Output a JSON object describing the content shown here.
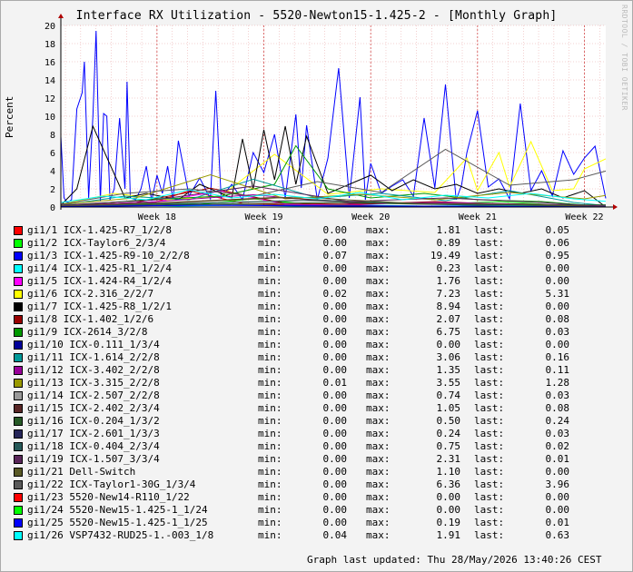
{
  "title": "Interface RX Utilization - 5520-Newton15-1.425-2 - [Monthly Graph]",
  "watermark": "RRDTOOL / TOBI OETIKER",
  "updated_text": "Graph last updated: Thu 28/May/2026 13:40:26 CEST",
  "legend_labels": {
    "min": "min:",
    "max": "max:",
    "last": "last:"
  },
  "colors": {
    "background": "#f3f3f3",
    "plot": "#ffffff",
    "grid": "#e7a2a2",
    "axis": "#000000"
  },
  "chart_data": {
    "type": "line",
    "title": "Interface RX Utilization - 5520-Newton15-1.425-2 - [Monthly Graph]",
    "xlabel": "",
    "ylabel": "Percent",
    "ylim": [
      0,
      20
    ],
    "yticks": [
      0,
      2,
      4,
      6,
      8,
      10,
      12,
      14,
      16,
      18,
      20
    ],
    "xlim": [
      17.1,
      22.2
    ],
    "xticks": [
      {
        "value": 18,
        "label": "Week 18"
      },
      {
        "value": 19,
        "label": "Week 19"
      },
      {
        "value": 20,
        "label": "Week 20"
      },
      {
        "value": 21,
        "label": "Week 21"
      },
      {
        "value": 22,
        "label": "Week 22"
      }
    ],
    "grid": true,
    "legend_position": "bottom",
    "series": [
      {
        "name": "gi1/1 ICX-1.425-R7_1/2/8",
        "color": "#ff0000",
        "min": "0.00",
        "max": "1.81",
        "last": "0.05",
        "x": [
          17.1,
          17.6,
          17.9,
          18.3,
          18.8,
          19.4,
          19.9,
          20.4,
          20.9,
          21.4,
          21.9,
          22.2
        ],
        "values": [
          0.1,
          0.3,
          0.2,
          1.8,
          0.4,
          0.2,
          0.3,
          0.5,
          0.2,
          0.3,
          0.2,
          0.05
        ]
      },
      {
        "name": "gi1/2 ICX-Taylor6_2/3/4",
        "color": "#00ff00",
        "min": "0.00",
        "max": "0.89",
        "last": "0.06",
        "x": [
          17.1,
          17.8,
          18.4,
          18.9,
          19.5,
          20.1,
          20.6,
          21.2,
          21.8,
          22.2
        ],
        "values": [
          0.1,
          0.5,
          0.3,
          0.9,
          0.2,
          0.4,
          0.3,
          0.6,
          0.2,
          0.06
        ]
      },
      {
        "name": "gi1/3 ICX-1.425-R9-10_2/2/8",
        "color": "#0000ff",
        "min": "0.07",
        "max": "19.49",
        "last": "0.95",
        "x": [
          17.1,
          17.13,
          17.16,
          17.2,
          17.25,
          17.3,
          17.32,
          17.36,
          17.4,
          17.43,
          17.47,
          17.5,
          17.53,
          17.56,
          17.6,
          17.65,
          17.7,
          17.72,
          17.75,
          17.8,
          17.85,
          17.9,
          17.95,
          18.0,
          18.05,
          18.1,
          18.15,
          18.2,
          18.3,
          18.4,
          18.5,
          18.55,
          18.6,
          18.7,
          18.8,
          18.9,
          19.0,
          19.1,
          19.2,
          19.3,
          19.35,
          19.4,
          19.5,
          19.6,
          19.7,
          19.8,
          19.9,
          19.95,
          20.0,
          20.1,
          20.2,
          20.3,
          20.4,
          20.5,
          20.6,
          20.7,
          20.8,
          20.85,
          20.9,
          21.0,
          21.1,
          21.2,
          21.3,
          21.4,
          21.5,
          21.6,
          21.7,
          21.8,
          21.9,
          22.0,
          22.1,
          22.2
        ],
        "values": [
          7.8,
          1.0,
          0.5,
          0.8,
          10.8,
          12.6,
          16.0,
          1.0,
          10.0,
          19.4,
          0.6,
          10.3,
          10.0,
          0.8,
          2.0,
          9.8,
          2.0,
          13.8,
          1.0,
          0.8,
          2.0,
          4.5,
          0.7,
          3.5,
          1.5,
          4.5,
          0.8,
          7.3,
          1.2,
          3.2,
          0.9,
          12.8,
          1.0,
          2.5,
          0.8,
          6.0,
          3.8,
          8.0,
          1.0,
          10.2,
          2.1,
          9.0,
          0.8,
          5.4,
          15.3,
          1.0,
          12.1,
          0.8,
          4.8,
          1.5,
          2.3,
          3.0,
          1.2,
          9.8,
          2.1,
          13.5,
          0.8,
          2.4,
          6.0,
          10.6,
          2.2,
          3.1,
          0.9,
          11.4,
          1.8,
          4.0,
          1.2,
          6.2,
          3.6,
          5.4,
          6.7,
          0.95
        ]
      },
      {
        "name": "gi1/4 ICX-1.425-R1_1/2/4",
        "color": "#00ffff",
        "min": "0.00",
        "max": "0.23",
        "last": "0.00",
        "x": [
          17.1,
          17.7,
          18.2,
          18.8,
          19.3,
          19.9,
          20.5,
          21.0,
          21.6,
          22.2
        ],
        "values": [
          0.1,
          0.2,
          0.1,
          0.2,
          0.1,
          0.23,
          0.1,
          0.15,
          0.1,
          0.0
        ]
      },
      {
        "name": "gi1/5 ICX-1.424-R4_1/2/4",
        "color": "#ff00ff",
        "min": "0.00",
        "max": "1.76",
        "last": "0.00",
        "x": [
          17.1,
          17.9,
          18.6,
          19.2,
          19.8,
          20.4,
          21.1,
          21.7,
          22.2
        ],
        "values": [
          0.1,
          0.4,
          1.76,
          0.3,
          0.2,
          0.5,
          0.3,
          0.2,
          0.0
        ]
      },
      {
        "name": "gi1/6 ICX-2.316_2/2/7",
        "color": "#ffff00",
        "min": "0.02",
        "max": "7.23",
        "last": "5.31",
        "x": [
          17.1,
          17.6,
          18.1,
          18.6,
          19.1,
          19.6,
          20.1,
          20.6,
          20.9,
          21.0,
          21.2,
          21.3,
          21.5,
          21.7,
          21.9,
          22.0,
          22.2
        ],
        "values": [
          0.3,
          1.5,
          0.8,
          1.2,
          5.8,
          1.4,
          2.0,
          1.6,
          5.4,
          1.8,
          6.0,
          2.2,
          7.2,
          1.8,
          2.0,
          4.2,
          5.31
        ]
      },
      {
        "name": "gi1/7 ICX-1.425-R8_1/2/1",
        "color": "#000000",
        "min": "0.00",
        "max": "8.94",
        "last": "0.00",
        "x": [
          17.1,
          17.25,
          17.4,
          17.7,
          17.9,
          18.2,
          18.4,
          18.7,
          18.8,
          18.9,
          19.0,
          19.1,
          19.2,
          19.3,
          19.4,
          19.6,
          19.8,
          20.0,
          20.2,
          20.4,
          20.6,
          20.8,
          21.0,
          21.2,
          21.4,
          21.6,
          21.8,
          22.0,
          22.2
        ],
        "values": [
          0.2,
          2.0,
          8.9,
          1.0,
          1.5,
          0.8,
          2.5,
          1.0,
          7.5,
          2.0,
          8.5,
          3.0,
          8.9,
          2.5,
          7.8,
          1.5,
          2.5,
          3.5,
          1.8,
          3.0,
          2.0,
          2.5,
          1.5,
          2.0,
          1.5,
          2.0,
          1.0,
          1.8,
          0.0
        ]
      },
      {
        "name": "gi1/8 ICX-1.402_1/2/6",
        "color": "#990000",
        "min": "0.00",
        "max": "2.07",
        "last": "0.08",
        "x": [
          17.1,
          17.8,
          18.5,
          19.2,
          19.9,
          20.6,
          21.3,
          22.2
        ],
        "values": [
          0.1,
          0.5,
          2.07,
          0.4,
          0.3,
          0.6,
          0.3,
          0.08
        ]
      },
      {
        "name": "gi1/9 ICX-2614_3/2/8",
        "color": "#009900",
        "min": "0.00",
        "max": "6.75",
        "last": "0.03",
        "x": [
          17.1,
          17.9,
          18.6,
          19.1,
          19.3,
          19.6,
          20.0,
          20.5,
          21.0,
          21.6,
          22.2
        ],
        "values": [
          0.1,
          0.8,
          1.2,
          2.5,
          6.75,
          2.0,
          1.0,
          1.5,
          0.8,
          0.6,
          0.03
        ]
      },
      {
        "name": "gi1/10 ICX-0.111_1/3/4",
        "color": "#000099",
        "min": "0.00",
        "max": "0.00",
        "last": "0.00",
        "x": [
          17.1,
          22.2
        ],
        "values": [
          0,
          0
        ]
      },
      {
        "name": "gi1/11 ICX-1.614_2/2/8",
        "color": "#009999",
        "min": "0.00",
        "max": "3.06",
        "last": "0.16",
        "x": [
          17.1,
          17.7,
          18.3,
          18.9,
          19.5,
          20.1,
          20.7,
          21.3,
          21.9,
          22.2
        ],
        "values": [
          0.2,
          1.2,
          0.8,
          3.06,
          1.0,
          1.5,
          0.7,
          1.8,
          0.5,
          0.16
        ]
      },
      {
        "name": "gi1/12 ICX-3.402_2/2/8",
        "color": "#990099",
        "min": "0.00",
        "max": "1.35",
        "last": "0.11",
        "x": [
          17.1,
          18.0,
          18.9,
          19.8,
          20.7,
          21.6,
          22.2
        ],
        "values": [
          0.1,
          0.6,
          1.35,
          0.4,
          0.5,
          0.3,
          0.11
        ]
      },
      {
        "name": "gi1/13 ICX-3.315_2/2/8",
        "color": "#999900",
        "min": "0.01",
        "max": "3.55",
        "last": "1.28",
        "x": [
          17.1,
          17.8,
          18.5,
          19.2,
          19.9,
          20.6,
          21.3,
          22.0,
          22.2
        ],
        "values": [
          0.3,
          1.0,
          3.55,
          0.9,
          1.4,
          0.8,
          1.6,
          0.9,
          1.28
        ]
      },
      {
        "name": "gi1/14 ICX-2.507_2/2/8",
        "color": "#999999",
        "min": "0.00",
        "max": "0.74",
        "last": "0.03",
        "x": [
          17.1,
          18.2,
          19.3,
          20.4,
          21.5,
          22.2
        ],
        "values": [
          0.1,
          0.4,
          0.74,
          0.3,
          0.2,
          0.03
        ]
      },
      {
        "name": "gi1/15 ICX-2.402_2/3/4",
        "color": "#592626",
        "min": "0.00",
        "max": "1.05",
        "last": "0.08",
        "x": [
          17.1,
          18.1,
          19.1,
          20.1,
          21.1,
          22.2
        ],
        "values": [
          0.1,
          0.5,
          1.05,
          0.4,
          0.3,
          0.08
        ]
      },
      {
        "name": "gi1/16 ICX-0.204_1/3/2",
        "color": "#265926",
        "min": "0.00",
        "max": "0.50",
        "last": "0.24",
        "x": [
          17.1,
          18.4,
          19.7,
          21.0,
          22.2
        ],
        "values": [
          0.1,
          0.3,
          0.5,
          0.2,
          0.24
        ]
      },
      {
        "name": "gi1/17 ICX-2.601_1/3/3",
        "color": "#262659",
        "min": "0.00",
        "max": "0.24",
        "last": "0.03",
        "x": [
          17.1,
          18.8,
          20.5,
          22.2
        ],
        "values": [
          0.1,
          0.24,
          0.1,
          0.03
        ]
      },
      {
        "name": "gi1/18 ICX-0.404_2/3/4",
        "color": "#265959",
        "min": "0.00",
        "max": "0.75",
        "last": "0.02",
        "x": [
          17.1,
          18.3,
          19.5,
          20.7,
          22.2
        ],
        "values": [
          0.1,
          0.4,
          0.75,
          0.3,
          0.02
        ]
      },
      {
        "name": "gi1/19 ICX-1.507_3/3/4",
        "color": "#592659",
        "min": "0.00",
        "max": "2.31",
        "last": "0.01",
        "x": [
          17.1,
          18.0,
          18.9,
          19.8,
          20.7,
          21.6,
          22.2
        ],
        "values": [
          0.2,
          0.8,
          2.31,
          0.6,
          1.0,
          0.5,
          0.01
        ]
      },
      {
        "name": "gi1/21 Dell-Switch",
        "color": "#595926",
        "min": "0.00",
        "max": "1.10",
        "last": "0.00",
        "x": [
          17.1,
          18.2,
          19.3,
          20.4,
          21.5,
          22.2
        ],
        "values": [
          0.1,
          0.5,
          1.1,
          0.4,
          0.3,
          0.0
        ]
      },
      {
        "name": "gi1/22 ICX-Taylor1-30G_1/3/4",
        "color": "#595959",
        "min": "0.00",
        "max": "6.36",
        "last": "3.96",
        "x": [
          17.1,
          17.7,
          18.3,
          18.9,
          19.5,
          20.1,
          20.7,
          21.3,
          21.9,
          22.2
        ],
        "values": [
          0.3,
          1.5,
          2.0,
          1.2,
          2.8,
          1.6,
          6.36,
          2.4,
          3.0,
          3.96
        ]
      },
      {
        "name": "gi1/23 5520-New14-R110_1/22",
        "color": "#ff0000",
        "min": "0.00",
        "max": "0.00",
        "last": "0.00",
        "x": [
          17.1,
          22.2
        ],
        "values": [
          0,
          0
        ]
      },
      {
        "name": "gi1/24 5520-New15-1.425-1_1/24",
        "color": "#00ff00",
        "min": "0.00",
        "max": "0.00",
        "last": "0.00",
        "x": [
          17.1,
          22.2
        ],
        "values": [
          0,
          0
        ]
      },
      {
        "name": "gi1/25 5520-New15-1.425-1_1/25",
        "color": "#0000ff",
        "min": "0.00",
        "max": "0.19",
        "last": "0.01",
        "x": [
          17.1,
          18.4,
          19.7,
          21.0,
          22.2
        ],
        "values": [
          0.05,
          0.19,
          0.1,
          0.08,
          0.01
        ]
      },
      {
        "name": "gi1/26 VSP7432-RUD25-1.-003_1/8",
        "color": "#00ffff",
        "min": "0.04",
        "max": "1.91",
        "last": "0.63",
        "x": [
          17.1,
          17.5,
          17.9,
          18.3,
          18.7,
          19.1,
          19.5,
          19.9,
          20.3,
          20.7,
          21.1,
          21.5,
          21.9,
          22.2
        ],
        "values": [
          0.5,
          1.2,
          0.8,
          1.9,
          1.0,
          1.4,
          0.9,
          1.6,
          0.8,
          1.3,
          1.0,
          1.5,
          0.9,
          0.63
        ]
      }
    ]
  }
}
